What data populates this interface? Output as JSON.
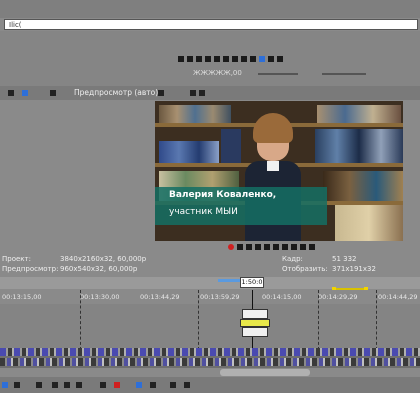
{
  "top_input": {
    "value": "Ilic("
  },
  "transport_time": "ЖЖЖЖЖ,00",
  "preview_toolbar": {
    "label": "Предпросмотр (авто)"
  },
  "preview_overlay": {
    "name": "Валерия Коваленко,",
    "role": "участник МЫИ"
  },
  "info": {
    "project_label": "Проект:",
    "project_value": "3840x2160x32, 60,000p",
    "preview_label": "Предпросмотр:",
    "preview_value": "960x540x32, 60,000p",
    "frame_label": "Кадр:",
    "frame_value": "51 332",
    "display_label": "Отобразить:",
    "display_value": "371x191x32"
  },
  "timeline": {
    "current_tc": "1:50:0",
    "ruler": [
      "00:13:15,00",
      "00:13:30,00",
      "00:13:44,29",
      "00:13:59,29",
      "00:14:15,00",
      "00:14:29,29",
      "00:14:44,29"
    ]
  },
  "colors": {
    "caption_bg": "#146e64",
    "clip_white": "#f0f0f0",
    "clip_yellow": "#e8e84a",
    "marker_yellow": "#f2d400"
  }
}
